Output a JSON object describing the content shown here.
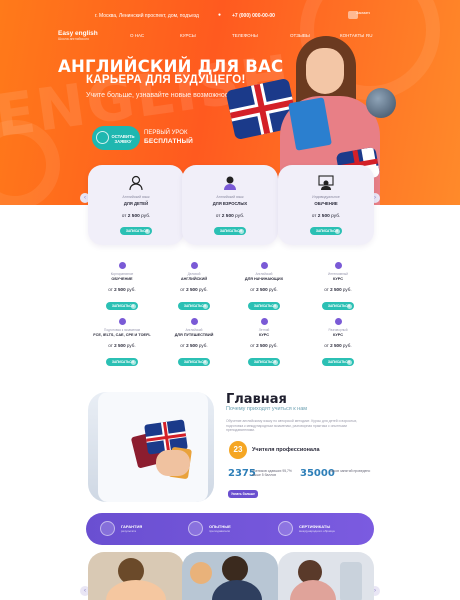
{
  "topbar": {
    "address": "г. Москва, Ленинский проспект, дом, подъезд",
    "phone": "+7 (000) 000-00-00",
    "top_button": "Заказать звонок"
  },
  "logo": {
    "name": "Easy english",
    "tagline": "Школа английского"
  },
  "nav": [
    "О НАС",
    "КУРСЫ",
    "ТЕЛЕФОНЫ",
    "ОТЗЫВЫ",
    "КОНТАКТЫ",
    "RU"
  ],
  "hero": {
    "bg_text": "ENGLISH",
    "title": "АНГЛИЙСКИЙ ДЛЯ ВАС",
    "subtitle": "КАРЬЕРА ДЛЯ БУДУЩЕГО!",
    "lead": "Учите больше, узнавайте новые возможности",
    "leave_button": "ОСТАВИТЬ ЗАЯВКУ",
    "first_lesson_line1": "ПЕРВЫЙ УРОК",
    "first_lesson_line2": "БЕСПЛАТНЫЙ"
  },
  "featured_courses": [
    {
      "category": "Английский язык",
      "title": "ДЛЯ ДЕТЕЙ",
      "price_prefix": "от",
      "price": "2 500",
      "price_unit": "руб.",
      "button": "ЗАПИСАТЬСЯ",
      "icon": "kids-icon"
    },
    {
      "category": "Английский язык",
      "title": "ДЛЯ ВЗРОСЛЫХ",
      "price_prefix": "от",
      "price": "2 500",
      "price_unit": "руб.",
      "button": "ЗАПИСАТЬСЯ",
      "icon": "adult-icon"
    },
    {
      "category": "Индивидуальное",
      "title": "ОБУЧЕНИЕ",
      "price_prefix": "от",
      "price": "2 500",
      "price_unit": "руб.",
      "button": "ЗАПИСАТЬСЯ",
      "icon": "teacher-icon"
    }
  ],
  "courses_grid": [
    {
      "category": "Корпоративное",
      "title": "ОБУЧЕНИЕ",
      "price": "2 500",
      "button": "ЗАПИСАТЬСЯ"
    },
    {
      "category": "Деловой",
      "title": "АНГЛИЙСКИЙ",
      "price": "2 500",
      "button": "ЗАПИСАТЬСЯ"
    },
    {
      "category": "Английский",
      "title": "ДЛЯ НАЧИНАЮЩИХ",
      "price": "2 500",
      "button": "ЗАПИСАТЬСЯ"
    },
    {
      "category": "Интенсивный",
      "title": "КУРС",
      "price": "2 500",
      "button": "ЗАПИСАТЬСЯ"
    },
    {
      "category": "Подготовка к экзаменам",
      "title": "FCE, IELTS, CAE, CPE И TOEFL",
      "price": "2 500",
      "button": "ЗАПИСАТЬСЯ"
    },
    {
      "category": "Английский",
      "title": "ДЛЯ ПУТЕШЕСТВИЙ",
      "price": "2 500",
      "button": "ЗАПИСАТЬСЯ"
    },
    {
      "category": "Летний",
      "title": "КУРС",
      "price": "2 500",
      "button": "ЗАПИСАТЬСЯ"
    },
    {
      "category": "Разговорный",
      "title": "КУРС",
      "price": "2 500",
      "button": "ЗАПИСАТЬСЯ"
    }
  ],
  "price_prefix": "от",
  "price_unit": "руб.",
  "about": {
    "title": "Главная",
    "subtitle": "Почему приходят учиться к нам",
    "text": "Обучение английскому языку по авторской методике. Курсы для детей и взрослых, подготовка к международным экзаменам, разговорная практика с опытными преподавателями.",
    "badge": "23",
    "badge_label": "Учителя профессионала",
    "stat1_value": "2375",
    "stat1_text": "Учеников сдавших 95,7% выше 5 баллов",
    "stat2_value": "35000",
    "stat2_text": "часов занятий проведено",
    "button": "Узнать больше"
  },
  "features": [
    {
      "title": "ГАРАНТИЯ",
      "subtitle": "результата",
      "icon": "shield-icon"
    },
    {
      "title": "ОПЫТНЫЕ",
      "subtitle": "преподаватели",
      "icon": "teacher-icon"
    },
    {
      "title": "СЕРТИФИКАТЫ",
      "subtitle": "международного образца",
      "icon": "graduation-cap-icon"
    }
  ],
  "colors": {
    "hero_orange": "#ff5a1f",
    "accent_teal": "#2bc0b4",
    "accent_purple": "#6a4fd1",
    "card_bg": "#f1eff9"
  }
}
